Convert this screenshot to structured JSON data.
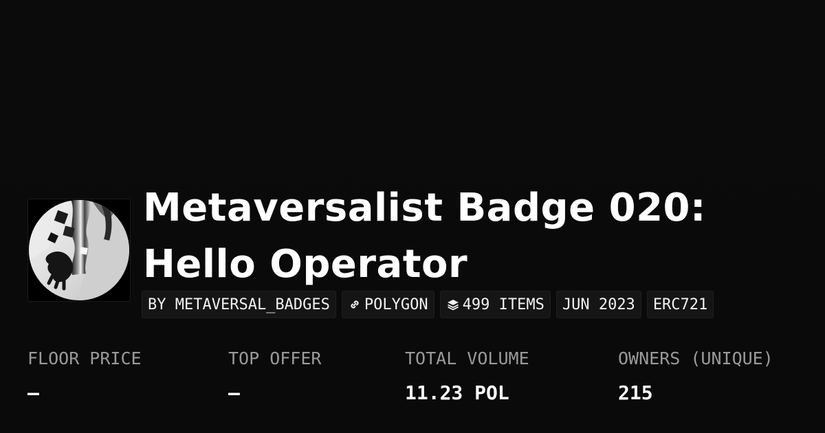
{
  "collection": {
    "title": "Metaversalist Badge 020: Hello Operator",
    "avatar_icon": "collection-avatar"
  },
  "tags": {
    "creator": "BY METAVERSAL_BADGES",
    "chain": "POLYGON",
    "chain_icon": "link-icon",
    "items": "499 ITEMS",
    "items_icon": "layers-icon",
    "date": "JUN 2023",
    "standard": "ERC721"
  },
  "stats": {
    "floor_price": {
      "label": "FLOOR PRICE",
      "value": "–"
    },
    "top_offer": {
      "label": "TOP OFFER",
      "value": "–"
    },
    "total_volume": {
      "label": "TOTAL VOLUME",
      "value": "11.23 POL"
    },
    "owners": {
      "label": "OWNERS (UNIQUE)",
      "value": "215"
    }
  },
  "colors": {
    "background": "#0b0b0b",
    "tag_background": "#151515",
    "label": "#9a9a9a",
    "text": "#ffffff"
  }
}
